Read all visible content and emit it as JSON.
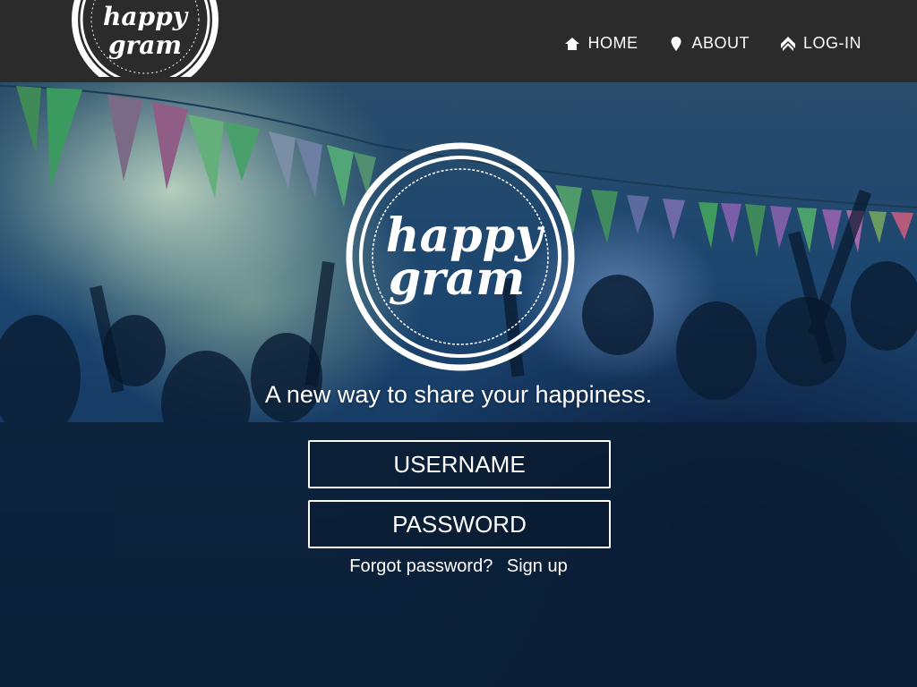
{
  "header": {
    "logo": {
      "text_top": "happy",
      "text_bottom": "gram"
    },
    "nav": [
      {
        "label": "HOME",
        "icon": "home-icon"
      },
      {
        "label": "ABOUT",
        "icon": "map-pin-icon"
      },
      {
        "label": "LOG-IN",
        "icon": "chevron-up-icon"
      }
    ]
  },
  "hero": {
    "logo": {
      "text_top": "happy",
      "text_bottom": "gram"
    },
    "tagline": "A new way to share your happiness.",
    "form": {
      "username_placeholder": "USERNAME",
      "password_placeholder": "PASSWORD"
    },
    "links": {
      "forgot": "Forgot password?",
      "signup": "Sign up"
    }
  },
  "colors": {
    "header_bg": "#2b2b2b",
    "text": "#ffffff"
  }
}
